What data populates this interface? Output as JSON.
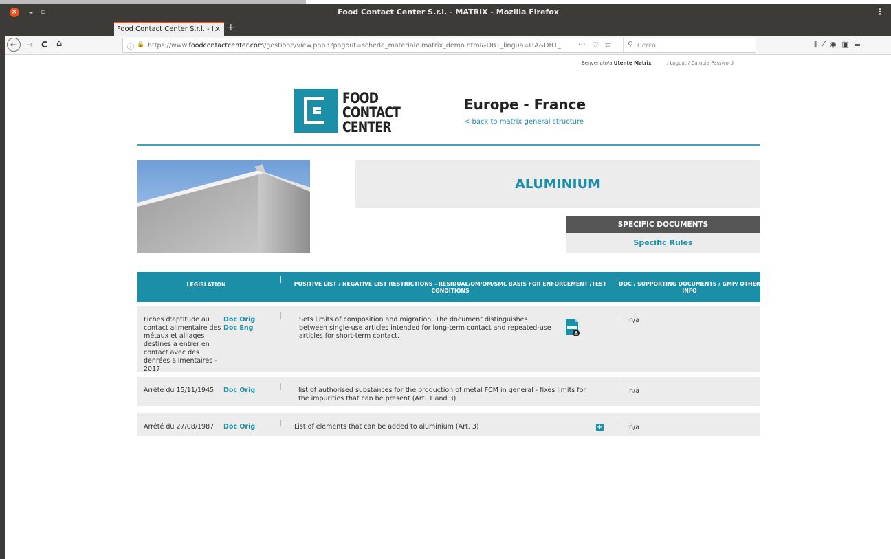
{
  "window": {
    "title": "Food Contact Center S.r.l. - MATRIX - Mozilla Firefox",
    "close_glyph": "×",
    "min_glyph": "–",
    "max_glyph": "▫",
    "menu_glyph": "⋮"
  },
  "tab": {
    "label": "Food Contact Center S.r.l. - I",
    "close_glyph": "✕",
    "new_tab_glyph": "+"
  },
  "nav": {
    "back_glyph": "←",
    "forward_glyph": "→",
    "reload_glyph": "C",
    "home_glyph": "⌂",
    "url_prefix": "https://www.",
    "url_domain": "foodcontactcenter.com",
    "url_path": "/gestione/view.php3?pagout=scheda_materiale.matrix_demo.html&DB1_lingua=ITA&DB1_",
    "info_glyph": "ⓘ",
    "lock_glyph": "🔒",
    "dots_glyph": "···",
    "pocket_glyph": "♡",
    "star_glyph": "☆",
    "search_glyph": "⚲",
    "search_placeholder": "Cerca",
    "right_icons": "⫼⁄◉▣≡"
  },
  "user": {
    "welcome": "Benvenuto/a",
    "name": "Utente Matrix",
    "logout": "/ Logout / Cambia Password"
  },
  "header": {
    "logo_text": "FOOD CONTACT CENTER",
    "heading": "Europe - France",
    "back_link": "< back to matrix general structure"
  },
  "material": {
    "title": "ALUMINIUM"
  },
  "specific": {
    "heading": "SPECIFIC DOCUMENTS",
    "link": "Specific Rules"
  },
  "table": {
    "headers": {
      "legislation": "LEGISLATION",
      "positive": "POSITIVE LIST / NEGATIVE LIST RESTRICTIONS - RESIDUAL/QM/OM/SML BASIS FOR ENFORCEMENT /TEST CONDITIONS",
      "doc": "DOC / SUPPORTING DOCUMENTS / GMP/ OTHER INFO"
    },
    "rows": [
      {
        "legislation": "Fiches d'aptitude au contact alimentaire des métaux et alliages destinés à entrer en contact avec des denrées alimentaires - 2017",
        "doc_orig": "Doc Orig",
        "doc_eng": "Doc Eng",
        "description": "Sets limits of composition and migration. The document distinguishes between single-use articles intended for long-term contact and repeated-use articles for short-term contact.",
        "info": "n/a"
      },
      {
        "legislation": "Arrêté du 15/11/1945",
        "doc_orig": "Doc Orig",
        "description": "list of authorised substances for the production of metal FCM in general - fixes limits for the impurities that can be present (Art. 1 and 3)",
        "info": "n/a"
      },
      {
        "legislation": "Arrêté du 27/08/1987",
        "doc_orig": "Doc Orig",
        "description": "List of elements that can be added to aluminium (Art. 3)",
        "info": "n/a",
        "plus_glyph": "+"
      }
    ]
  },
  "colors": {
    "accent": "#1b8fa7",
    "titlebar": "#3c3b37",
    "close_button": "#e95420",
    "panel": "#ececec",
    "dark_panel": "#555555"
  }
}
